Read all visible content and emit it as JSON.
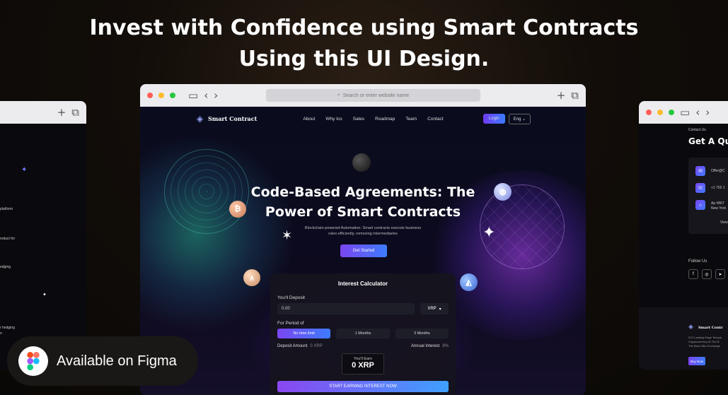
{
  "headline": {
    "line1": "Invest with Confidence using Smart Contracts",
    "line2": "Using this UI Design."
  },
  "browser": {
    "address_placeholder": "Search or enter website name"
  },
  "site": {
    "brand": "Smart Contract",
    "nav": [
      "About",
      "Why Ico",
      "Sales",
      "Roadmap",
      "Team",
      "Contact"
    ],
    "login": "Login",
    "lang": "Eng",
    "hero_title_1": "Code-Based Agreements: The",
    "hero_title_2": "Power of Smart Contracts",
    "hero_sub": "Blockchain-powered Automation: Smart contracts execute business rules efficiently, removing intermediaries",
    "get_started": "Get Started"
  },
  "calculator": {
    "title": "Interest Calculator",
    "deposit_label": "You'll Deposit",
    "deposit_value": "0.00",
    "currency": "XRP",
    "period_label": "For Period of",
    "periods": [
      "No time limit",
      "1 Months",
      "3 Months"
    ],
    "deposit_amount_label": "Deposit Amount",
    "deposit_amount_value": "0 XRP",
    "annual_interest_label": "Annual Interest",
    "annual_interest_value": "8%",
    "earn_label": "You'll Earn",
    "earn_value": "0 XRP",
    "cta": "START EARNING INTEREST NOW"
  },
  "left_site": {
    "snippets": [
      "platform",
      "roduct for",
      "edging",
      "r hedging",
      "o"
    ]
  },
  "right_site": {
    "crumb": "Contact Us",
    "title": "Get A Qu",
    "contact": [
      "Offer@C",
      "+1 702 1",
      "Ap #867",
      "New York"
    ],
    "view": "View",
    "follow": "Follow Us",
    "brand": "Smart Contr",
    "footer_text": [
      "ICO Landing Page Templa",
      "Cryptocurrency At The B",
      "The Best Offer Exchange"
    ],
    "buy_now": "Buy Now"
  },
  "figma_badge": "Available on Figma",
  "colors": {
    "accent_purple": "#7b46f0",
    "accent_blue": "#3d7bff",
    "background": "#120d09"
  }
}
